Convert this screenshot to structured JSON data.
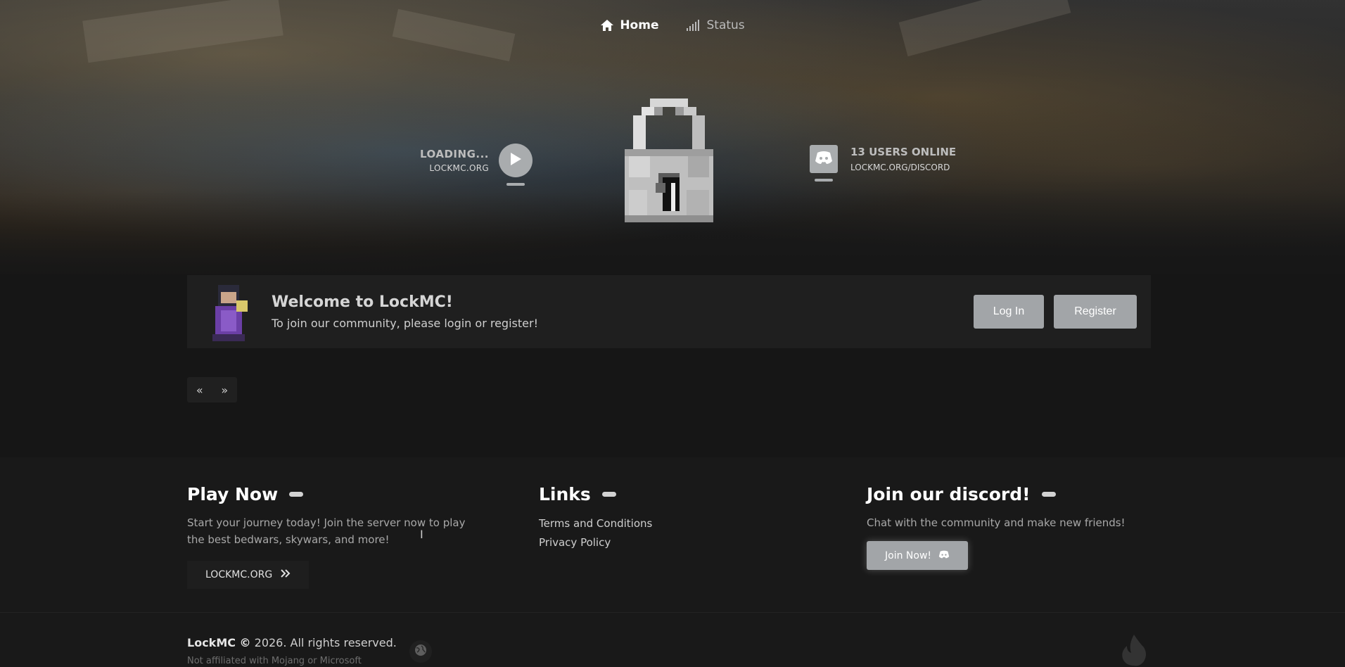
{
  "nav": {
    "items": [
      {
        "label": "Home",
        "icon": "home-icon",
        "active": true
      },
      {
        "label": "Status",
        "icon": "signal-icon",
        "active": false
      }
    ]
  },
  "server": {
    "status": "LOADING...",
    "address": "LOCKMC.ORG"
  },
  "discord": {
    "online": "13 USERS ONLINE",
    "link": "LOCKMC.ORG/DISCORD"
  },
  "welcome": {
    "title": "Welcome to LockMC!",
    "subtitle": "To join our community, please login or register!",
    "login_label": "Log In",
    "register_label": "Register"
  },
  "pager": {
    "prev": "«",
    "next": "»"
  },
  "footer": {
    "play": {
      "title": "Play Now",
      "text": "Start your journey today! Join the server now to play the best bedwars, skywars, and more!",
      "button": "LOCKMC.ORG"
    },
    "links": {
      "title": "Links",
      "items": [
        "Terms and Conditions",
        "Privacy Policy"
      ]
    },
    "discord": {
      "title": "Join our discord!",
      "text": "Chat with the community and make new friends!",
      "button": "Join Now!"
    },
    "brand": "LockMC ©",
    "copyright_rest": " 2026. All rights reserved.",
    "disclaimer": "Not affiliated with Mojang or Microsoft"
  },
  "colors": {
    "background": "#161616",
    "panel": "#1f1f1f",
    "button": "#a2a5a8"
  }
}
